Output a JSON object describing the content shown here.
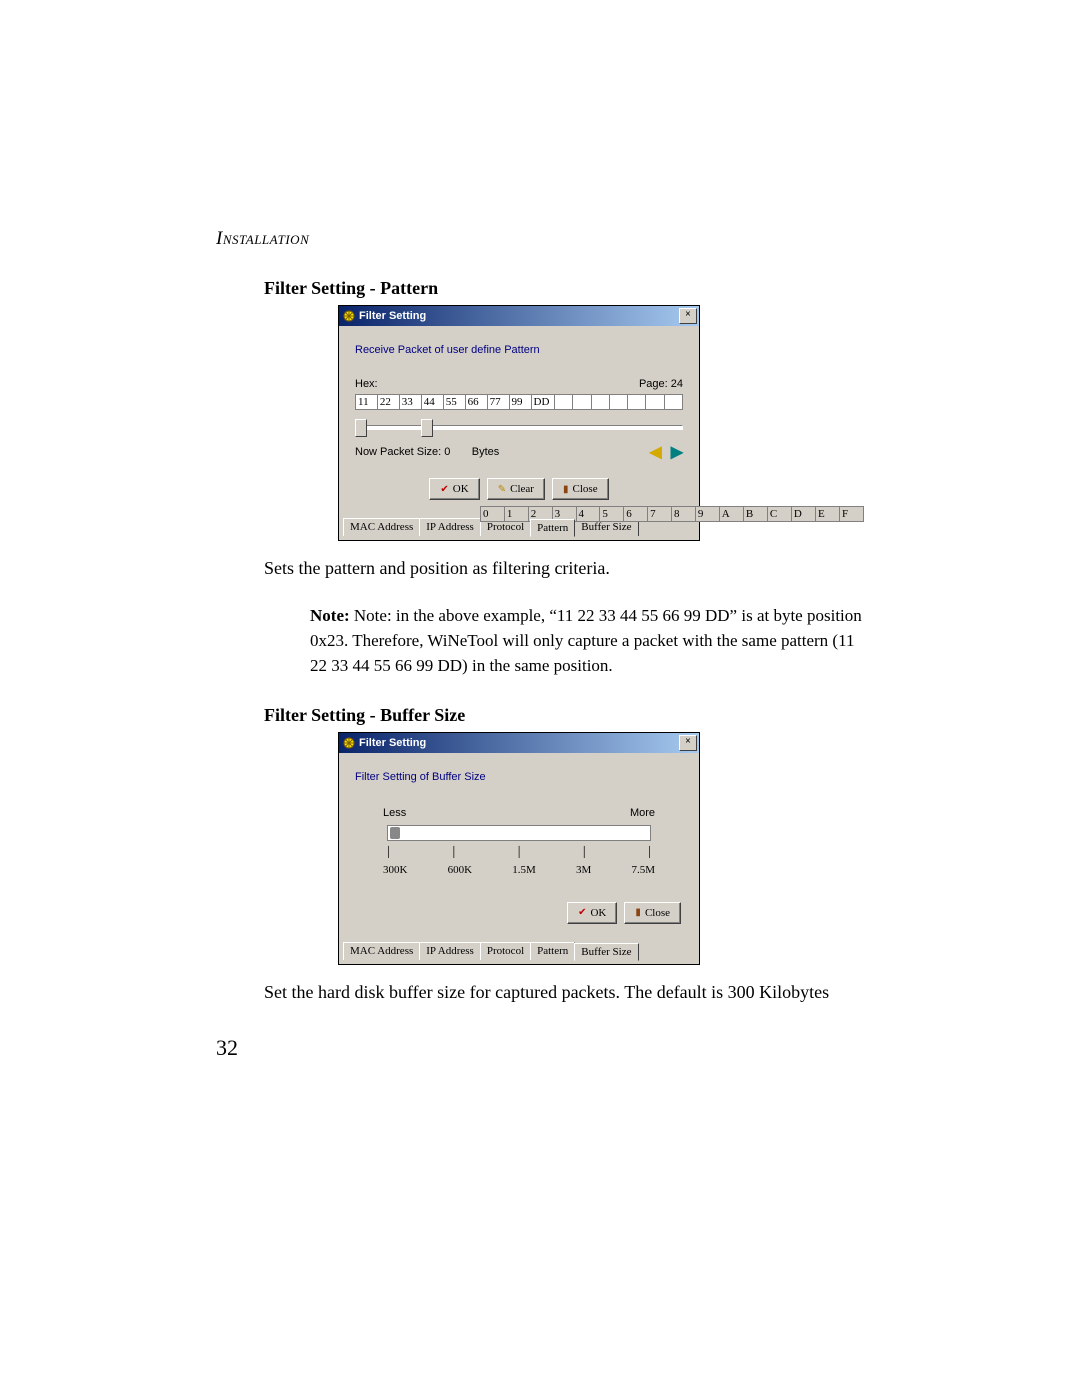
{
  "header": "Installation",
  "page_number": "32",
  "section1": {
    "heading": "Filter Setting - Pattern",
    "caption": "Sets the pattern and position as filtering criteria.",
    "note_label": "Note:",
    "note_body": "Note: in the above example, “11 22 33 44 55 66 99 DD” is at byte position 0x23. Therefore, WiNeTool will only capture a packet with the same pattern (11 22 33 44 55 66 99 DD) in the same position."
  },
  "dialog1": {
    "title": "Filter Setting",
    "body_text": "Receive Packet of user define Pattern",
    "hex_label": "Hex:",
    "page_label": "Page: 24",
    "hex_headers": [
      "0",
      "1",
      "2",
      "3",
      "4",
      "5",
      "6",
      "7",
      "8",
      "9",
      "A",
      "B",
      "C",
      "D",
      "E",
      "F"
    ],
    "hex_values": [
      "11",
      "22",
      "33",
      "44",
      "55",
      "66",
      "77",
      "99",
      "DD",
      "",
      "",
      "",
      "",
      "",
      "",
      ""
    ],
    "packet_size_label": "Now Packet Size: 0",
    "bytes_label": "Bytes",
    "buttons": {
      "ok": "OK",
      "clear": "Clear",
      "close": "Close"
    },
    "tabs": [
      "MAC Address",
      "IP Address",
      "Protocol",
      "Pattern",
      "Buffer Size"
    ],
    "active_tab": "Pattern"
  },
  "section2": {
    "heading": "Filter Setting - Buffer Size",
    "caption": "Set the hard disk buffer size for captured packets. The default is 300 Kilobytes"
  },
  "dialog2": {
    "title": "Filter Setting",
    "body_text": "Filter Setting of Buffer Size",
    "less_label": "Less",
    "more_label": "More",
    "scale": [
      "300K",
      "600K",
      "1.5M",
      "3M",
      "7.5M"
    ],
    "buttons": {
      "ok": "OK",
      "close": "Close"
    },
    "tabs": [
      "MAC Address",
      "IP Address",
      "Protocol",
      "Pattern",
      "Buffer Size"
    ],
    "active_tab": "Buffer Size"
  }
}
